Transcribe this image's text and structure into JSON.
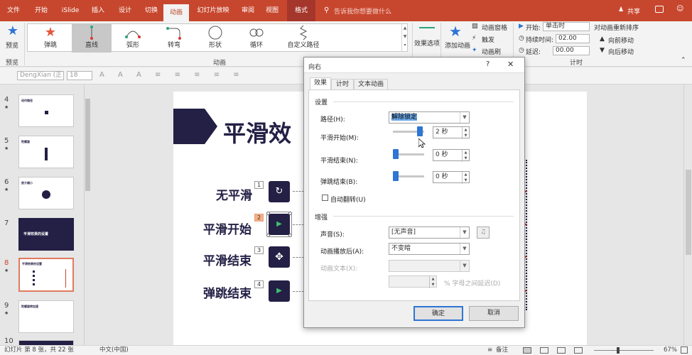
{
  "menubar": {
    "tabs": [
      "文件",
      "开始",
      "iSlide",
      "插入",
      "设计",
      "切换",
      "动画",
      "幻灯片放映",
      "审阅",
      "视图",
      "格式"
    ],
    "search": "告诉我你想要做什么",
    "share": "共享"
  },
  "ribbon": {
    "preview": "预览",
    "preview_group": "预览",
    "animations": [
      "弹跳",
      "直线",
      "弧形",
      "转弯",
      "形状",
      "循环",
      "自定义路径"
    ],
    "selected_animation": "直线",
    "effect_options": "效果选项",
    "animation_group": "动画",
    "add_animation": "添加动画",
    "animation_pane": "动画窗格",
    "trigger": "触发",
    "animation_painter": "动画刷",
    "start_label": "开始:",
    "start_value": "单击时",
    "duration_label": "持续时间:",
    "duration_value": "02.00",
    "delay_label": "延迟:",
    "delay_value": "00.00",
    "timing_group": "计时",
    "reorder": "对动画重新排序",
    "move_earlier": "向前移动",
    "move_later": "向后移动"
  },
  "format": {
    "font": "DengXian (正",
    "size": "18"
  },
  "slides": [
    {
      "num": "4",
      "star": "★",
      "title": "动作路径"
    },
    {
      "num": "5",
      "star": "★",
      "title": "陀螺旋"
    },
    {
      "num": "6",
      "star": "★",
      "title": "放大缩小"
    },
    {
      "num": "7",
      "star": "",
      "title": "平滑效果的设置"
    },
    {
      "num": "8",
      "star": "★",
      "title": "平滑效果的设置"
    },
    {
      "num": "9",
      "star": "★",
      "title": "陀螺旋转加速"
    },
    {
      "num": "10",
      "star": "",
      "title": ""
    }
  ],
  "canvas": {
    "title": "平滑效",
    "labels": [
      "无平滑",
      "平滑开始",
      "平滑结束",
      "弹跳结束"
    ],
    "tags": [
      "1",
      "2",
      "3",
      "4"
    ]
  },
  "dialog": {
    "title": "向右",
    "help": "?",
    "close": "✕",
    "tabs": [
      "效果",
      "计时",
      "文本动画"
    ],
    "settings_header": "设置",
    "path_label": "路径(H):",
    "path_value": "解除锁定",
    "smooth_start_label": "平滑开始(M):",
    "smooth_start_value": "2 秒",
    "smooth_start_level": 1.0,
    "smooth_end_label": "平滑结束(N):",
    "smooth_end_value": "0 秒",
    "smooth_end_level": 0.0,
    "bounce_end_label": "弹跳结束(B):",
    "bounce_end_value": "0 秒",
    "bounce_end_level": 0.0,
    "auto_reverse": "自动翻转(U)",
    "enhance_header": "增强",
    "sound_label": "声音(S):",
    "sound_value": "[无声音]",
    "after_label": "动画播放后(A):",
    "after_value": "不变暗",
    "text_label": "动画文本(X):",
    "text_value": "",
    "delay_between": "% 字母之间延迟(D)",
    "ok": "确定",
    "cancel": "取消"
  },
  "status": {
    "slide_info": "幻灯片 第 8 张，共 22 张",
    "language": "中文(中国)",
    "notes": "备注",
    "zoom": "67%"
  },
  "colors": {
    "accent": "#c7472e",
    "navy": "#231f45"
  }
}
